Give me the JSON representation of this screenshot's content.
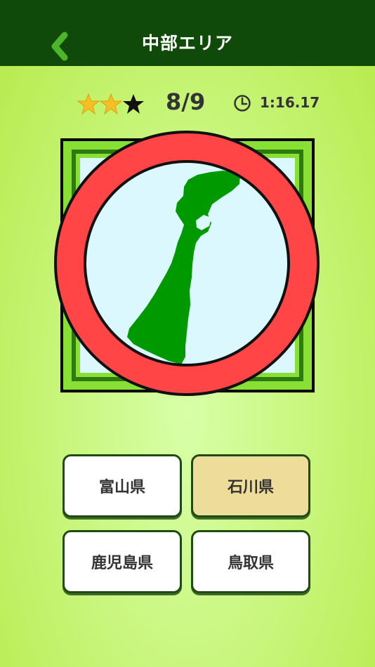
{
  "header": {
    "title": "中部エリア",
    "back_icon": "chevron-left-icon"
  },
  "status": {
    "stars_earned": 2,
    "stars_total": 3,
    "score": "8/9",
    "timer_icon": "clock-icon",
    "time": "1:16.17"
  },
  "quiz": {
    "result_icon": "correct-circle-icon",
    "map_region": "ishikawa-prefecture-map"
  },
  "answers": [
    {
      "label": "富山県",
      "selected": false
    },
    {
      "label": "石川県",
      "selected": true
    },
    {
      "label": "鹿児島県",
      "selected": false
    },
    {
      "label": "鳥取県",
      "selected": false
    }
  ],
  "colors": {
    "header_bg": "#0f4a0a",
    "accent_green": "#4cb52a",
    "map_green": "#009900",
    "result_red": "#ff4545",
    "star_gold": "#f5c023",
    "selected_answer_bg": "#eddc9a"
  }
}
